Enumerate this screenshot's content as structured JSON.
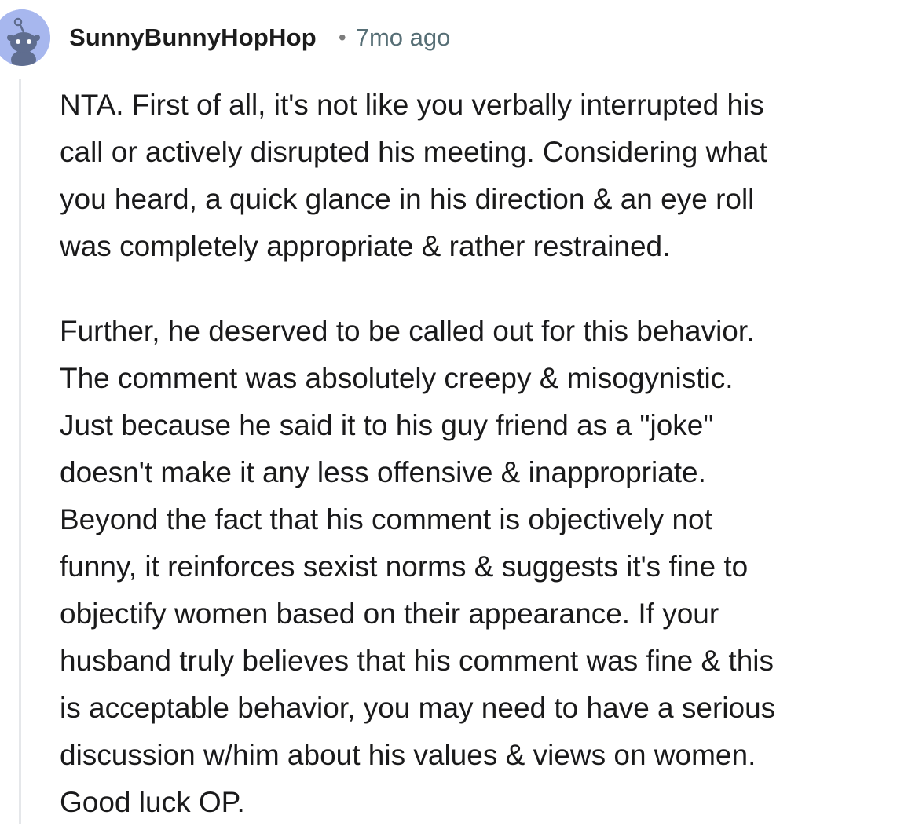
{
  "comment": {
    "username": "SunnyBunnyHopHop",
    "separator": "•",
    "timestamp": "7mo ago",
    "paragraphs": [
      {
        "lines": [
          "NTA. First of all, it's not like you verbally interrupted his",
          "call or actively disrupted his meeting. Considering what",
          "you heard, a quick glance in his direction & an eye roll",
          "was completely appropriate & rather restrained."
        ]
      },
      {
        "lines": [
          "Further, he deserved to be called out for this behavior.",
          "The comment was absolutely creepy & misogynistic.",
          "Just because he said it to his guy friend as a \"joke\"",
          "doesn't make it any less offensive & inappropriate.",
          "Beyond the fact that his comment is objectively not",
          "funny, it reinforces sexist norms & suggests it's fine to",
          "objectify women based on their appearance. If your",
          "husband truly believes that his comment was fine & this",
          "is acceptable behavior, you may need to have a serious",
          "discussion w/him about his values & views on women.",
          "Good luck OP."
        ]
      }
    ]
  },
  "colors": {
    "avatar_bg": "#a7b7ee",
    "thread_line": "#e5e7ea",
    "timestamp": "#576f76"
  },
  "icons": {
    "avatar": "snoo-avatar-icon"
  }
}
